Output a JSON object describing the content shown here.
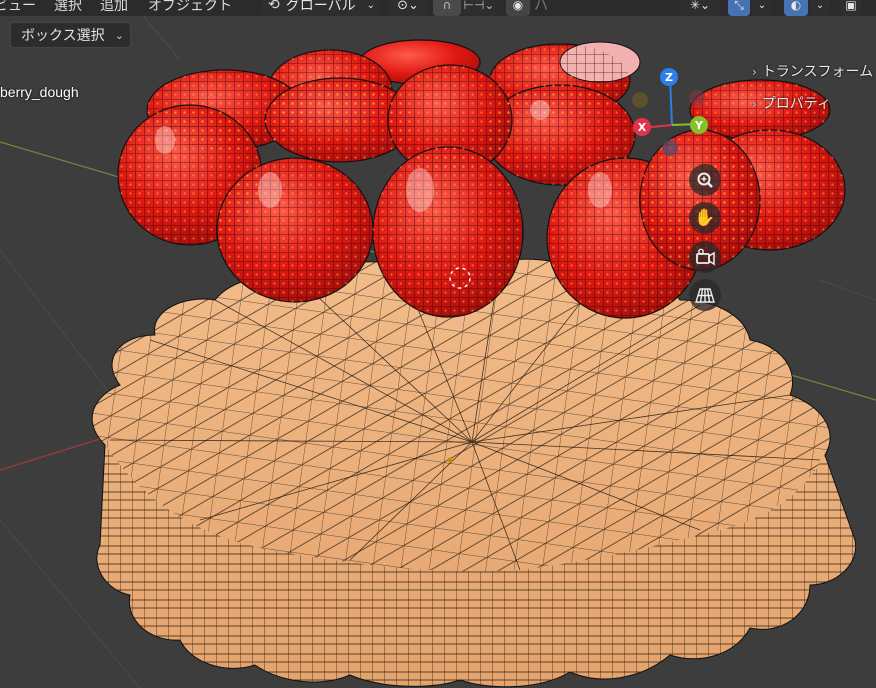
{
  "header": {
    "menu": {
      "view": "ビュー",
      "select": "選択",
      "add": "追加",
      "object": "オブジェクト"
    },
    "transform_orientation": "グローバル",
    "snap_increment_label": "ハ"
  },
  "toolbar": {
    "select_mode": "ボックス選択"
  },
  "viewport": {
    "object_name": "berry_dough"
  },
  "sidebar": {
    "panels": [
      "トランスフォーム",
      "プロパティ"
    ]
  },
  "gizmo": {
    "x_label": "X",
    "y_label": "Y",
    "z_label": "Z",
    "x_color": "#e0334d",
    "y_color": "#83c229",
    "z_color": "#2d7ee8"
  },
  "colors": {
    "viewport_bg": "#3d3d3d",
    "dough": "#eaaa72",
    "strawberry": "#e31a17",
    "wire": "#111111",
    "x_axis_line": "#a03a3a",
    "y_axis_line": "#6f8a3a",
    "accent_blue": "#4772b3"
  }
}
